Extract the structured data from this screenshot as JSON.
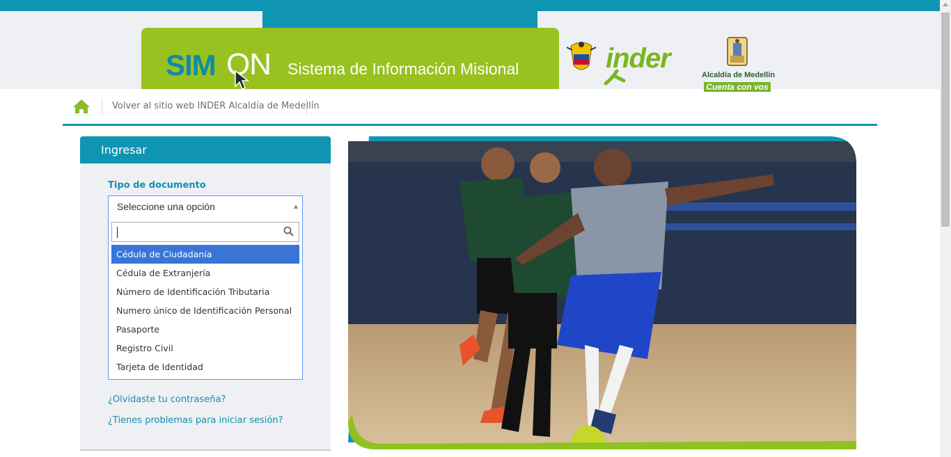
{
  "header": {
    "logo_simon": "SIM",
    "logo_on": "ON",
    "title": "Sistema de Información Misional",
    "inder_logo": "inder",
    "alcaldia_line1": "Alcaldía de Medellín",
    "alcaldia_line2": "Cuenta con vos"
  },
  "nav": {
    "home_icon": "home-icon",
    "back_link": "Volver al sitio web INDER Alcaldía de Medellín"
  },
  "login": {
    "panel_title": "Ingresar",
    "document_type_label": "Tipo de documento",
    "select": {
      "selected": "Seleccione una opción",
      "search_value": "",
      "options": [
        "Cédula de Ciudadanía",
        "Cédula de Extranjería",
        "Número de Identificación Tributaria",
        "Numero único de Identificación Personal",
        "Pasaporte",
        "Registro Civil",
        "Tarjeta de Identidad"
      ],
      "highlighted_index": 0
    },
    "forgot_password": "¿Olvidaste tu contraseña?",
    "login_problems": "¿Tienes problemas para iniciar sesión?"
  },
  "colors": {
    "accent": "#0f95b2",
    "banner_green": "#98c21f",
    "highlight": "#3875d7",
    "panel_bg": "#eef0f4"
  }
}
